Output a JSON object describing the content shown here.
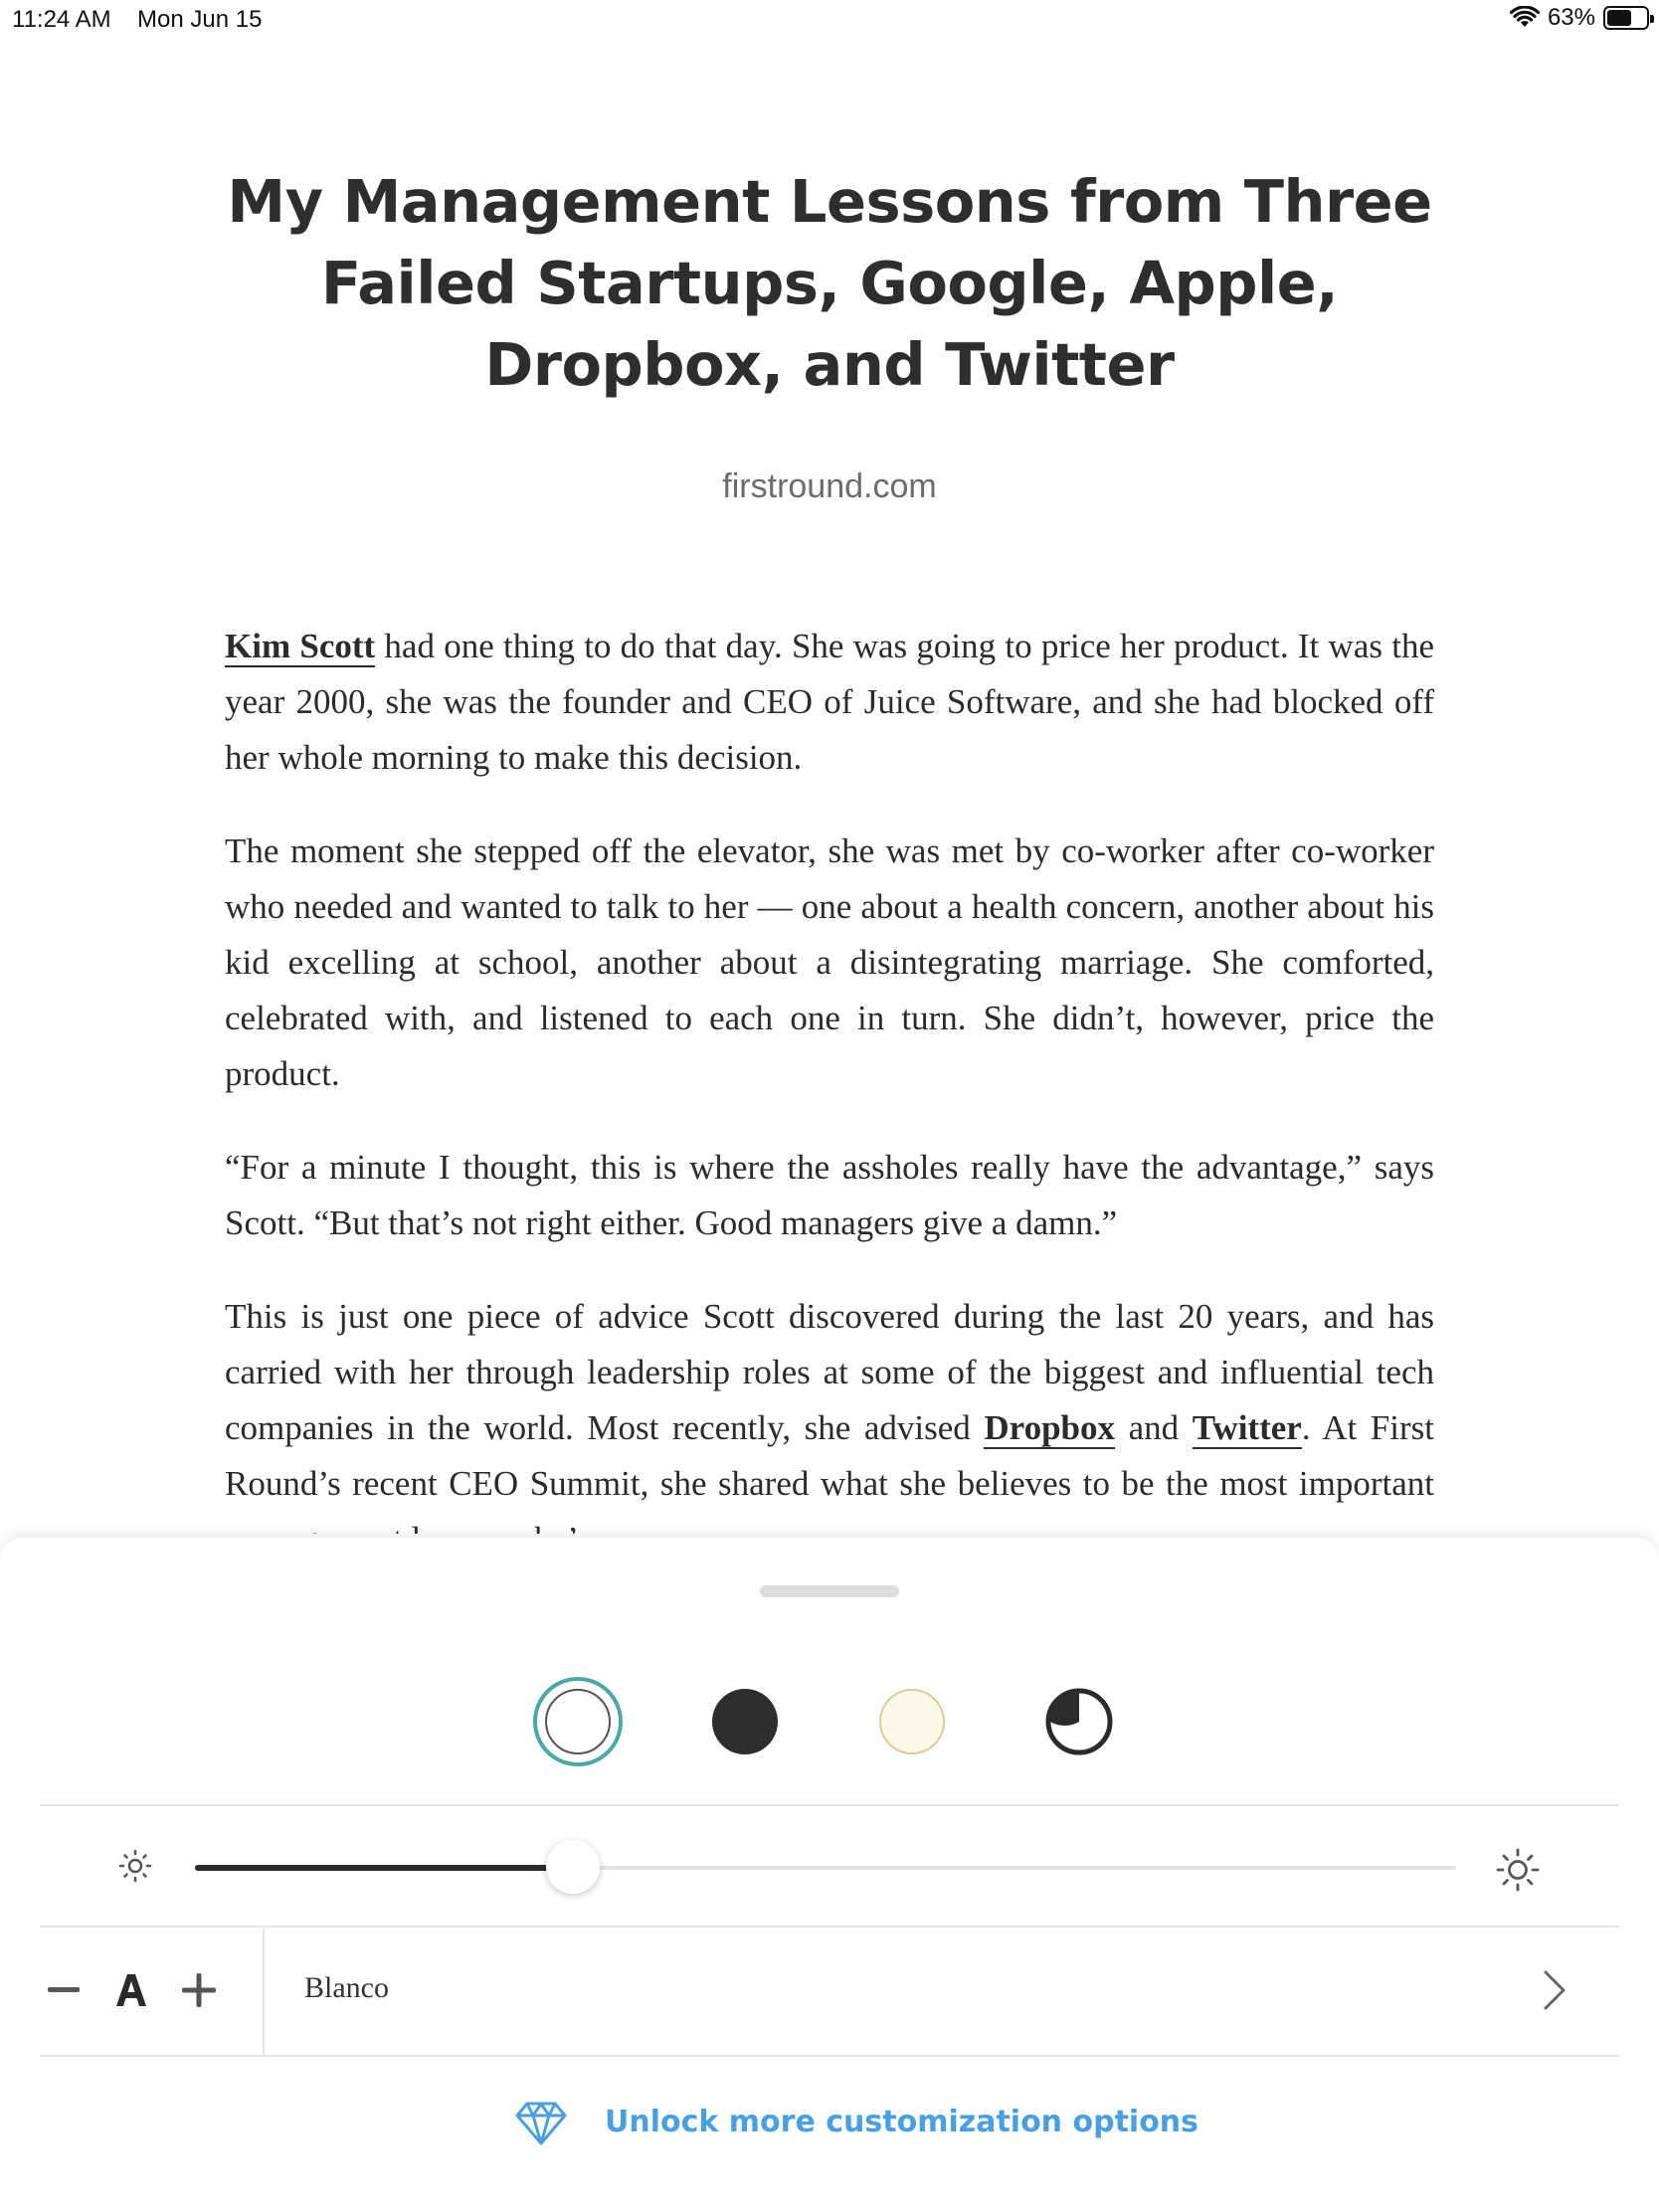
{
  "status_bar": {
    "time": "11:24 AM",
    "date": "Mon Jun 15",
    "battery": "63%",
    "battery_level": 0.63
  },
  "article": {
    "title": "My Management Lessons from Three Failed Startups, Google, Apple, Dropbox, and Twitter",
    "source": "firstround.com",
    "p1": {
      "link": "Kim Scott",
      "text": " had one thing to do that day. She was going to price her product. It was the year 2000, she was the founder and CEO of Juice Software, and she had blocked off her whole morning to make this decision."
    },
    "p2": "The moment she stepped off the elevator, she was met by co-worker after co-worker who needed and wanted to talk to her — one about a health concern, another about his kid excelling at school, another about a disintegrating marriage. She comforted, celebrated with, and listened to each one in turn. She didn’t, however, price the product.",
    "p3": "“For a minute I thought, this is where the assholes really have the advantage,” says Scott. “But that’s not right either. Good managers give a damn.”",
    "p4": {
      "text1": "This is just one piece of advice Scott discovered during the last 20 years, and has carried with her through leadership roles at some of the biggest and influential tech companies in the world. Most recently, she advised ",
      "link1": "Dropbox",
      "text2": " and ",
      "link2": "Twitter",
      "text3": ". At First Round’s recent CEO Summit, she shared what she believes to be the most important management lessons she’s"
    }
  },
  "settings_sheet": {
    "themes": [
      {
        "name": "white",
        "selected": true
      },
      {
        "name": "dark",
        "selected": false
      },
      {
        "name": "sepia",
        "selected": false
      },
      {
        "name": "auto",
        "selected": false
      }
    ],
    "brightness": 0.3,
    "font_name": "Blanco",
    "unlock_label": "Unlock more customization options",
    "accent_color": "#4a9fe0",
    "selected_ring_color": "#4aa9a4"
  }
}
